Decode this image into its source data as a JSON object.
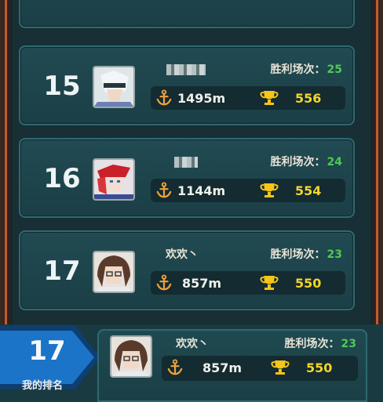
{
  "wins_label": "胜利场次：",
  "entries": [
    {
      "rank": "15",
      "name": "",
      "distance": "1495m",
      "score": "556",
      "wins": "25"
    },
    {
      "rank": "16",
      "name": "",
      "distance": "1144m",
      "score": "554",
      "wins": "24"
    },
    {
      "rank": "17",
      "name": "欢欢丶",
      "distance": "857m",
      "score": "550",
      "wins": "23"
    }
  ],
  "my_rank": {
    "rank": "17",
    "label": "我的排名",
    "name": "欢欢丶",
    "distance": "857m",
    "score": "550",
    "wins": "23"
  },
  "colors": {
    "wins_value": "#4ecb52",
    "score": "#f5d42a",
    "card_border": "#2e6a72",
    "frame_accent": "#c45a2c"
  },
  "icons": [
    "anchor-icon",
    "trophy-icon",
    "avatar"
  ]
}
